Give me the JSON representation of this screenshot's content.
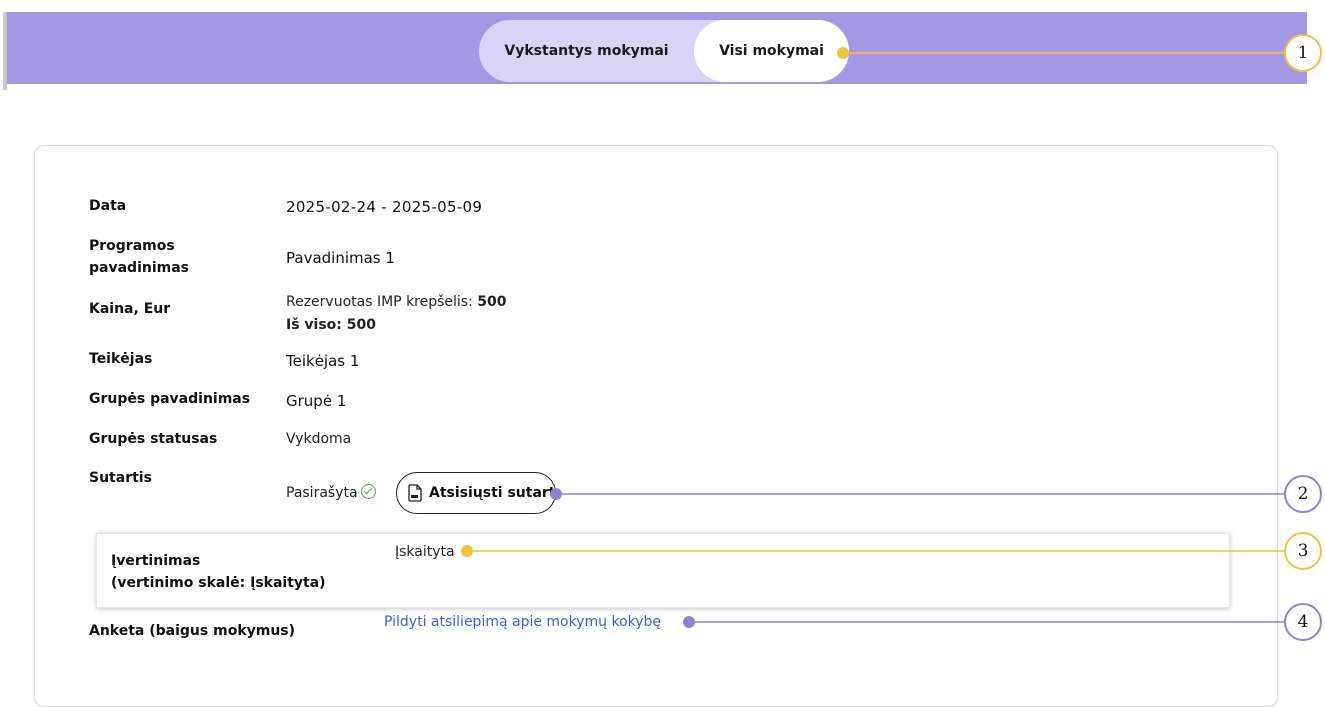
{
  "tabs": [
    {
      "label": "Vykstantys mokymai",
      "active": false
    },
    {
      "label": "Visi mokymai",
      "active": true
    }
  ],
  "details": {
    "date_label": "Data",
    "date_value": "2025-02-24 - 2025-05-09",
    "program_label_line1": "Programos",
    "program_label_line2": "pavadinimas",
    "program_value": "Pavadinimas 1",
    "price_label": "Kaina, Eur",
    "price_reserved_text": "Rezervuotas IMP krepšelis: ",
    "price_reserved_amount": "500",
    "price_total": "Iš viso: 500",
    "provider_label": "Teikėjas",
    "provider_value": "Teikėjas 1",
    "group_name_label": "Grupės pavadinimas",
    "group_name_value": "Grupė 1",
    "group_status_label": "Grupės statusas",
    "group_status_value": "Vykdoma",
    "contract_label": "Sutartis",
    "contract_status": "Pasirašyta",
    "download_button": "Atsisiųsti sutartį"
  },
  "rating": {
    "label_line1": "Įvertinimas",
    "label_line2": "(vertinimo skalė: Įskaityta)",
    "value": "Įskaityta"
  },
  "survey": {
    "label": "Anketa (baigus mokymus)",
    "link": "Pildyti atsiliepimą apie mokymų kokybę"
  },
  "callouts": [
    "1",
    "2",
    "3",
    "4"
  ],
  "colors": {
    "header": "#a497e3",
    "tab_track": "#d9d4f6",
    "callout_yellow": "#f2c23e",
    "callout_purple": "#8b82d8",
    "link": "#3d5ae8",
    "success": "#5aa05a"
  },
  "icons": [
    "check-circle-icon",
    "pdf-file-icon"
  ]
}
